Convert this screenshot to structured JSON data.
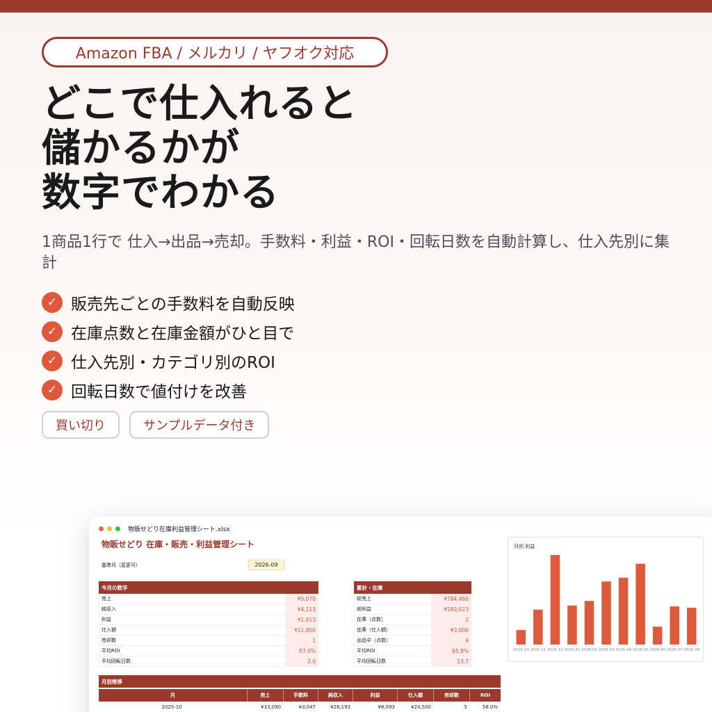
{
  "hero": {
    "platforms": "Amazon FBA / メルカリ / ヤフオク対応",
    "headline": [
      "どこで仕入れると",
      "儲かるかが",
      "数字でわかる"
    ],
    "description": "1商品1行で 仕入→出品→売却。手数料・利益・ROI・回転日数を自動計算し、仕入先別に集計",
    "features": [
      "販売先ごとの手数料を自動反映",
      "在庫点数と在庫金額がひと目で",
      "仕入先別・カテゴリ別のROI",
      "回転日数で値付けを改善"
    ],
    "tags": [
      "買い切り",
      "サンプルデータ付き"
    ]
  },
  "colors": {
    "brand": "#9b3a2c",
    "accent": "#e0583a",
    "bar": "#dd5a3a"
  },
  "icons": {
    "feature_check": "check-icon"
  },
  "sheet": {
    "filename": "物販せどり在庫利益管理シート.xlsx",
    "title": "物販せどり 在庫・販売・利益管理シート",
    "base_month_label": "基準月（変更可）",
    "base_month_value": "2026-09",
    "this_month": {
      "header": "今月の数字",
      "rows": [
        {
          "label": "売上",
          "value": "¥5,070"
        },
        {
          "label": "純収入",
          "value": "¥4,113"
        },
        {
          "label": "利益",
          "value": "¥1,913"
        },
        {
          "label": "仕入額",
          "value": "¥11,800"
        },
        {
          "label": "売却数",
          "value": "1"
        },
        {
          "label": "平均ROI",
          "value": "87.0%"
        },
        {
          "label": "平均回転日数",
          "value": "2.0"
        }
      ]
    },
    "cumulative": {
      "header": "累計・在庫",
      "rows": [
        {
          "label": "総売上",
          "value": "¥784,460"
        },
        {
          "label": "総利益",
          "value": "¥283,023"
        },
        {
          "label": "在庫（点数）",
          "value": "2"
        },
        {
          "label": "在庫（仕入額）",
          "value": "¥3,000"
        },
        {
          "label": "出品中（点数）",
          "value": "9"
        },
        {
          "label": "平均ROI",
          "value": "65.8%"
        },
        {
          "label": "平均回転日数",
          "value": "13.7"
        }
      ]
    },
    "monthly": {
      "header": "月別推移",
      "columns": [
        "月",
        "売上",
        "手数料",
        "純収入",
        "利益",
        "仕入額",
        "売却数",
        "ROI"
      ],
      "rows": [
        [
          "2025-10",
          "¥33,090",
          "¥3,047",
          "¥28,193",
          "¥8,093",
          "¥24,500",
          "5",
          "58.0%"
        ]
      ]
    }
  },
  "chart_data": {
    "type": "bar",
    "title": "月別 利益",
    "categories": [
      "2025-10",
      "2025-11",
      "2025-12",
      "2026-01",
      "2026-02",
      "2026-03",
      "2026-04",
      "2026-05",
      "2026-06",
      "2026-07",
      "2026-08"
    ],
    "values": [
      8093,
      19500,
      50000,
      21800,
      24400,
      35200,
      37300,
      45100,
      10000,
      21300,
      20500
    ],
    "ylim": [
      0,
      52000
    ]
  }
}
